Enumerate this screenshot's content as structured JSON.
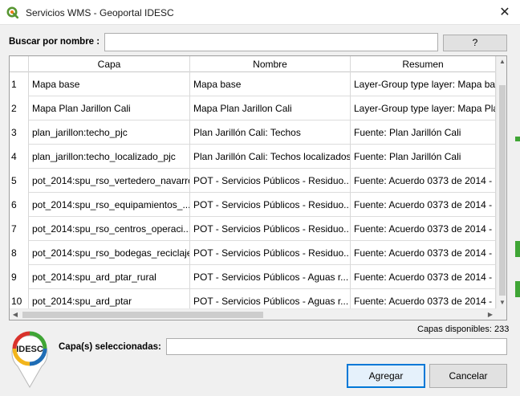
{
  "window": {
    "title": "Servicios WMS - Geoportal IDESC",
    "close_label": "✕"
  },
  "search": {
    "label": "Buscar por nombre :",
    "value": "",
    "help_label": "?"
  },
  "table": {
    "headers": [
      "Capa",
      "Nombre",
      "Resumen"
    ],
    "rows": [
      {
        "num": "1",
        "capa": "Mapa base",
        "nombre": "Mapa base",
        "resumen": "Layer-Group type layer: Mapa bas"
      },
      {
        "num": "2",
        "capa": "Mapa Plan Jarillon Cali",
        "nombre": "Mapa Plan Jarillon Cali",
        "resumen": "Layer-Group type layer: Mapa Plan"
      },
      {
        "num": "3",
        "capa": "plan_jarillon:techo_pjc",
        "nombre": "Plan Jarillón Cali: Techos",
        "resumen": "Fuente: Plan Jarillón Cali"
      },
      {
        "num": "4",
        "capa": "plan_jarillon:techo_localizado_pjc",
        "nombre": "Plan Jarillón Cali: Techos localizados",
        "resumen": "Fuente: Plan Jarillón Cali"
      },
      {
        "num": "5",
        "capa": "pot_2014:spu_rso_vertedero_navarro",
        "nombre": "POT - Servicios Públicos - Residuo...",
        "resumen": "Fuente: Acuerdo 0373 de 2014 - Pl"
      },
      {
        "num": "6",
        "capa": "pot_2014:spu_rso_equipamientos_...",
        "nombre": "POT - Servicios Públicos - Residuo...",
        "resumen": "Fuente: Acuerdo 0373 de 2014 - Pl"
      },
      {
        "num": "7",
        "capa": "pot_2014:spu_rso_centros_operaci...",
        "nombre": "POT - Servicios Públicos - Residuo...",
        "resumen": "Fuente: Acuerdo 0373 de 2014 - Pl"
      },
      {
        "num": "8",
        "capa": "pot_2014:spu_rso_bodegas_reciclaje",
        "nombre": "POT - Servicios Públicos - Residuo...",
        "resumen": "Fuente: Acuerdo 0373 de 2014 - Pl"
      },
      {
        "num": "9",
        "capa": "pot_2014:spu_ard_ptar_rural",
        "nombre": "POT - Servicios Públicos - Aguas r...",
        "resumen": "Fuente: Acuerdo 0373 de 2014 - Pl"
      },
      {
        "num": "10",
        "capa": "pot_2014:spu_ard_ptar",
        "nombre": "POT - Servicios Públicos - Aguas r...",
        "resumen": "Fuente: Acuerdo 0373 de 2014 - Pl"
      }
    ]
  },
  "status": {
    "available_text": "Capas disponibles: 233"
  },
  "selection": {
    "label": "Capa(s) seleccionadas:",
    "value": ""
  },
  "buttons": {
    "add_label": "Agregar",
    "cancel_label": "Cancelar"
  },
  "logo": {
    "text": "IDESC"
  },
  "icons": {
    "app": "qgis-icon",
    "close": "close-icon",
    "scroll_up": "chevron-up-icon",
    "scroll_down": "chevron-down-icon",
    "scroll_left": "chevron-left-icon",
    "scroll_right": "chevron-right-icon"
  },
  "colors": {
    "accent": "#0078d7",
    "qgis_green": "#589632",
    "logo_red": "#d9322b",
    "logo_blue": "#1f6db5",
    "logo_green": "#3fa535"
  }
}
